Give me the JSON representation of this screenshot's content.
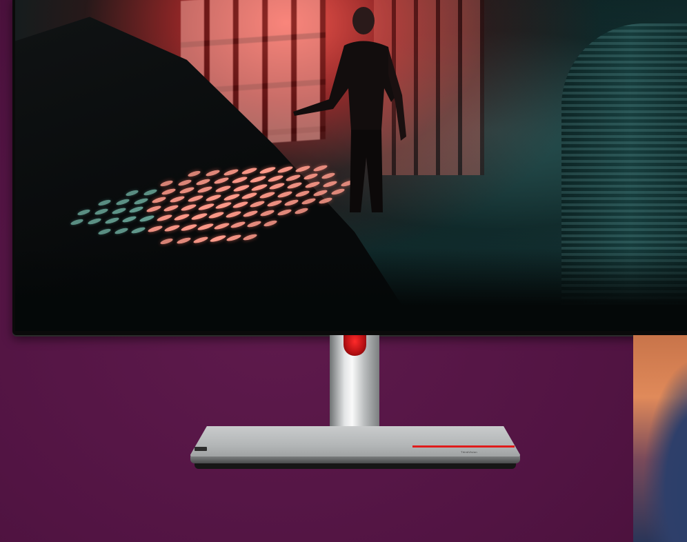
{
  "scene": {
    "subject": "monitor",
    "colors": {
      "background": "#541545",
      "accent_red": "#e01b1b",
      "stand_silver": "#c9cbcc"
    }
  },
  "base": {
    "brand_text": "ThinkVision"
  }
}
